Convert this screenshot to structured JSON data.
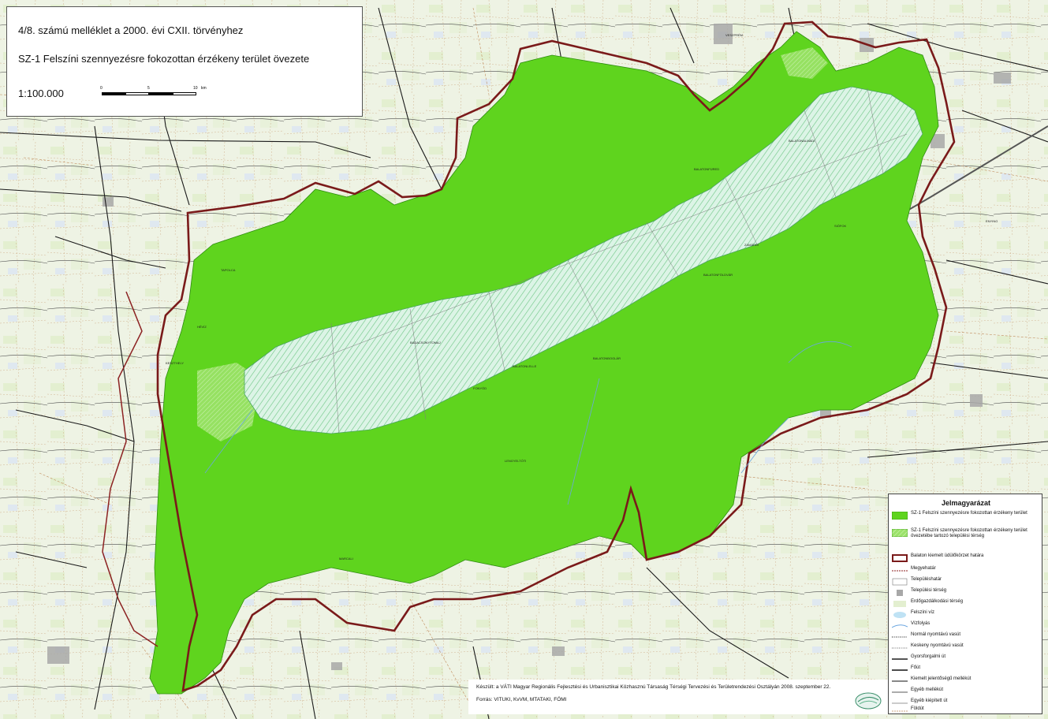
{
  "title": {
    "line1": "4/8. számú melléklet a 2000. évi CXII. törvényhez",
    "line2": "SZ-1 Felszíni szennyezésre fokozottan érzékeny terület övezete",
    "scale": "1:100.000"
  },
  "scalebar": {
    "ticks": [
      "0",
      "5",
      "10"
    ],
    "unit": "km"
  },
  "colors": {
    "zone_green": "#5fd41e",
    "lake": "#d6f2e2",
    "lake_hatch": "#7ccf90",
    "county_boundary": "#7a1a1a",
    "background": "#f1f4ea",
    "road": "#1a1a1a"
  },
  "legend": {
    "title": "Jelmagyarázat",
    "items": [
      {
        "label": "SZ-1 Felszíni szennyezésre fokozottan érzékeny terület",
        "symbol": "green-fill"
      },
      {
        "label": "SZ-1 Felszíni szennyezésre fokozottan érzékeny terület övezetébe tartozó települési térség",
        "symbol": "green-hatch"
      },
      {
        "label": "Balaton kiemelt üdülőkörzet határa",
        "symbol": "boundary-thick"
      },
      {
        "label": "Megyehatár",
        "symbol": "county-line"
      },
      {
        "label": "Településhatár",
        "symbol": "settlement-line"
      },
      {
        "label": "Települési térség",
        "symbol": "grey-fill"
      },
      {
        "label": "Erdőgazdálkodási térség",
        "symbol": "light-green-fill"
      },
      {
        "label": "Felszíni víz",
        "symbol": "water-fill"
      },
      {
        "label": "Vízfolyás",
        "symbol": "stream-line"
      },
      {
        "label": "Normál nyomtávú vasút",
        "symbol": "rail-normal"
      },
      {
        "label": "Keskeny nyomtávú vasút",
        "symbol": "rail-narrow"
      },
      {
        "label": "Gyorsforgalmi út",
        "symbol": "road-express"
      },
      {
        "label": "Főút",
        "symbol": "road-main"
      },
      {
        "label": "Kiemelt jelentőségű mellékút",
        "symbol": "road-secondary"
      },
      {
        "label": "Egyéb mellékút",
        "symbol": "road-other"
      },
      {
        "label": "Egyéb kiépített út",
        "symbol": "road-built"
      },
      {
        "label": "Földút",
        "symbol": "road-dirt"
      }
    ]
  },
  "credits": {
    "line1": "Készült: a VÁTI Magyar Regionális Fejlesztési és Urbanisztikai Közhasznú Társaság Térségi Tervezési és Területrendezési Osztályán 2008. szeptember 22.",
    "line2": "Forrás: VITUKI, KvVM, MTATAKI, FÖMI"
  },
  "places": [
    {
      "name": "BALATONALMÁDI"
    },
    {
      "name": "BALATONFÜRED"
    },
    {
      "name": "BALATONFÖLDVÁR"
    },
    {
      "name": "BADACSONYTOMAJ"
    },
    {
      "name": "SIÓFOK"
    },
    {
      "name": "ZAMÁRDI"
    },
    {
      "name": "FONYÓD"
    },
    {
      "name": "KESZTHELY"
    },
    {
      "name": "BALATONBOGLÁR"
    },
    {
      "name": "TAPOLCA"
    },
    {
      "name": "LENGYELTÓTI"
    },
    {
      "name": "VESZPRÉM"
    },
    {
      "name": "HÉVÍZ"
    },
    {
      "name": "BALATONLELLE"
    },
    {
      "name": "ENYING"
    },
    {
      "name": "MARCALI"
    }
  ]
}
